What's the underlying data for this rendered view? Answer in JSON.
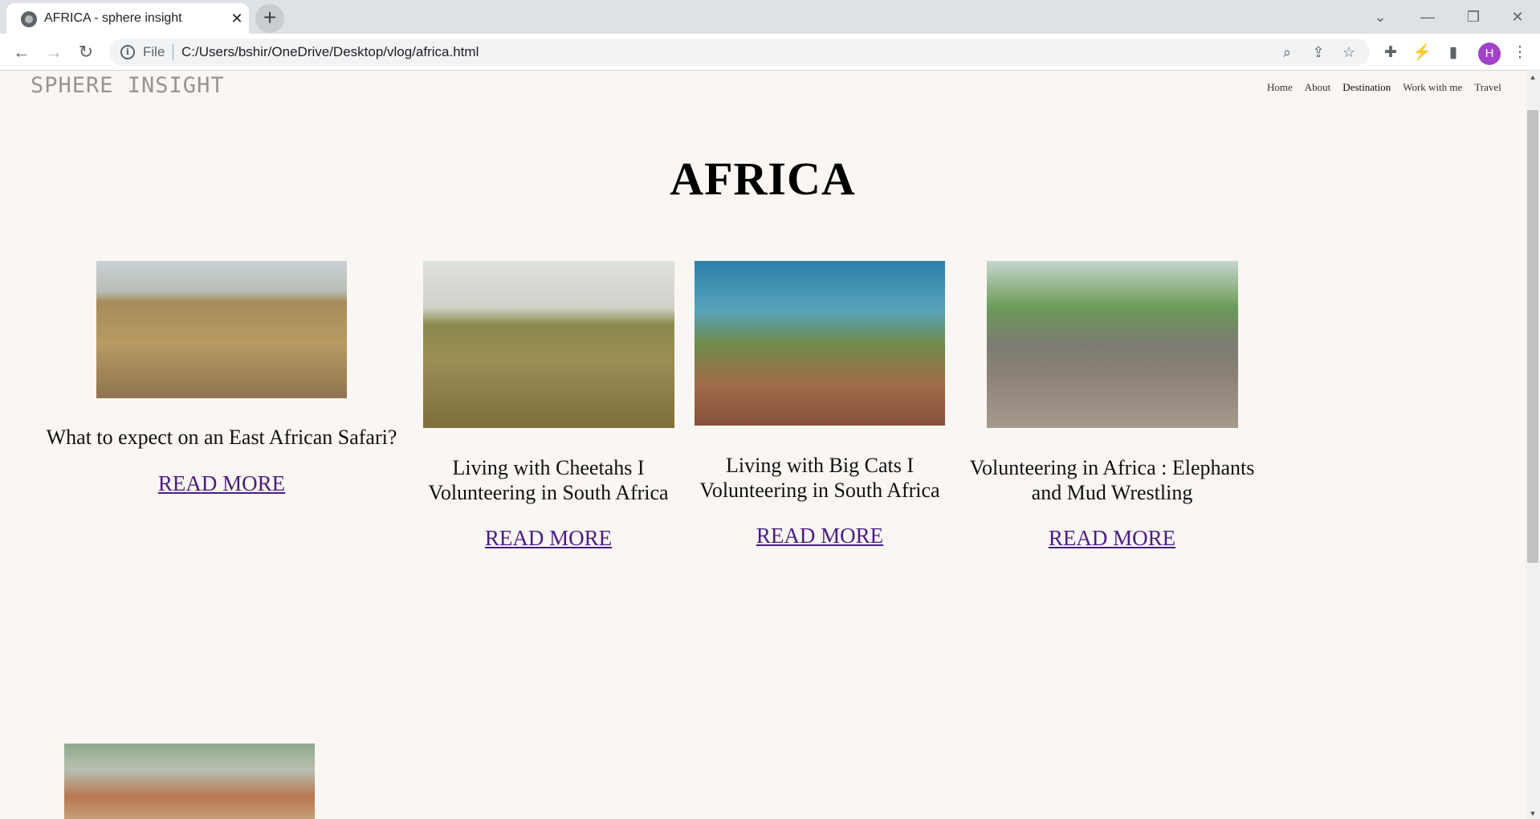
{
  "browser": {
    "tab_title": "AFRICA - sphere insight",
    "new_tab_label": "+",
    "file_label": "File",
    "url": "C:/Users/bshir/OneDrive/Desktop/vlog/africa.html",
    "profile_initial": "H"
  },
  "site": {
    "logo": "SPHERE INSIGHT",
    "nav": [
      "Home",
      "About",
      "Destination",
      "Work with me",
      "Travel"
    ]
  },
  "page": {
    "heading": "AFRICA",
    "read_more": "READ MORE",
    "cards": [
      {
        "title": "What to expect on an East African Safari?",
        "image": "safari-photographer-elephants"
      },
      {
        "title": "Living with Cheetahs I Volunteering in South Africa",
        "image": "cheetahs-in-grass"
      },
      {
        "title": "Living with Big Cats I Volunteering in South Africa",
        "image": "woman-with-zebras"
      },
      {
        "title": "Volunteering in Africa : Elephants and Mud Wrestling",
        "image": "elephants-in-water"
      },
      {
        "title": "",
        "image": "woman-with-lions"
      }
    ]
  }
}
